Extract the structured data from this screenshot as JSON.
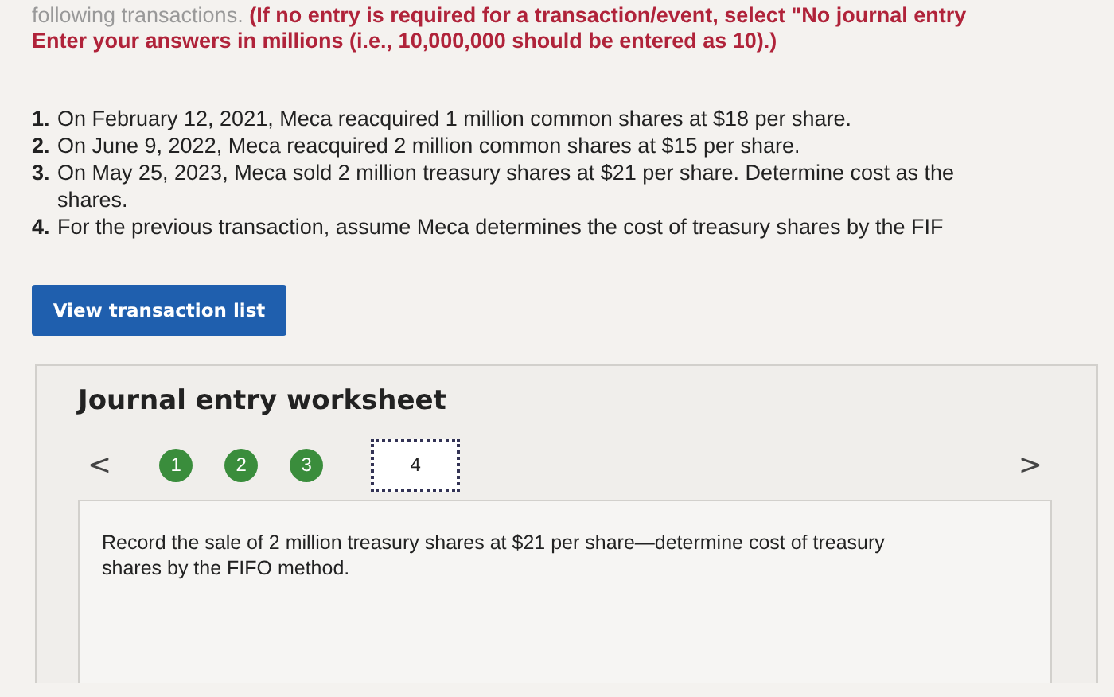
{
  "instructions": {
    "lead": "following transactions.",
    "notice": "(If no entry is required for a transaction/event, select \"No journal entry",
    "units": "Enter your answers in millions (i.e., 10,000,000 should be entered as 10).)"
  },
  "transactions": [
    {
      "number": "1.",
      "lines": [
        "On February 12, 2021, Meca reacquired 1 million common shares at $18 per share."
      ]
    },
    {
      "number": "2.",
      "lines": [
        "On June 9, 2022, Meca reacquired 2 million common shares at $15 per share."
      ]
    },
    {
      "number": "3.",
      "lines": [
        "On May 25, 2023, Meca sold 2 million treasury shares at $21 per share. Determine cost as the",
        "shares."
      ]
    },
    {
      "number": "4.",
      "lines": [
        "For the previous transaction, assume Meca determines the cost of treasury shares by the FIF"
      ]
    }
  ],
  "view_button": "View transaction list",
  "worksheet": {
    "title": "Journal entry worksheet",
    "prev": "<",
    "next": ">",
    "steps": [
      {
        "label": "1",
        "completed": true,
        "selected": false
      },
      {
        "label": "2",
        "completed": true,
        "selected": false
      },
      {
        "label": "3",
        "completed": true,
        "selected": false
      },
      {
        "label": "4",
        "completed": false,
        "selected": true
      }
    ],
    "prompt": "Record the sale of 2 million treasury shares at $21 per share—determine cost of treasury shares by the FIFO method."
  }
}
